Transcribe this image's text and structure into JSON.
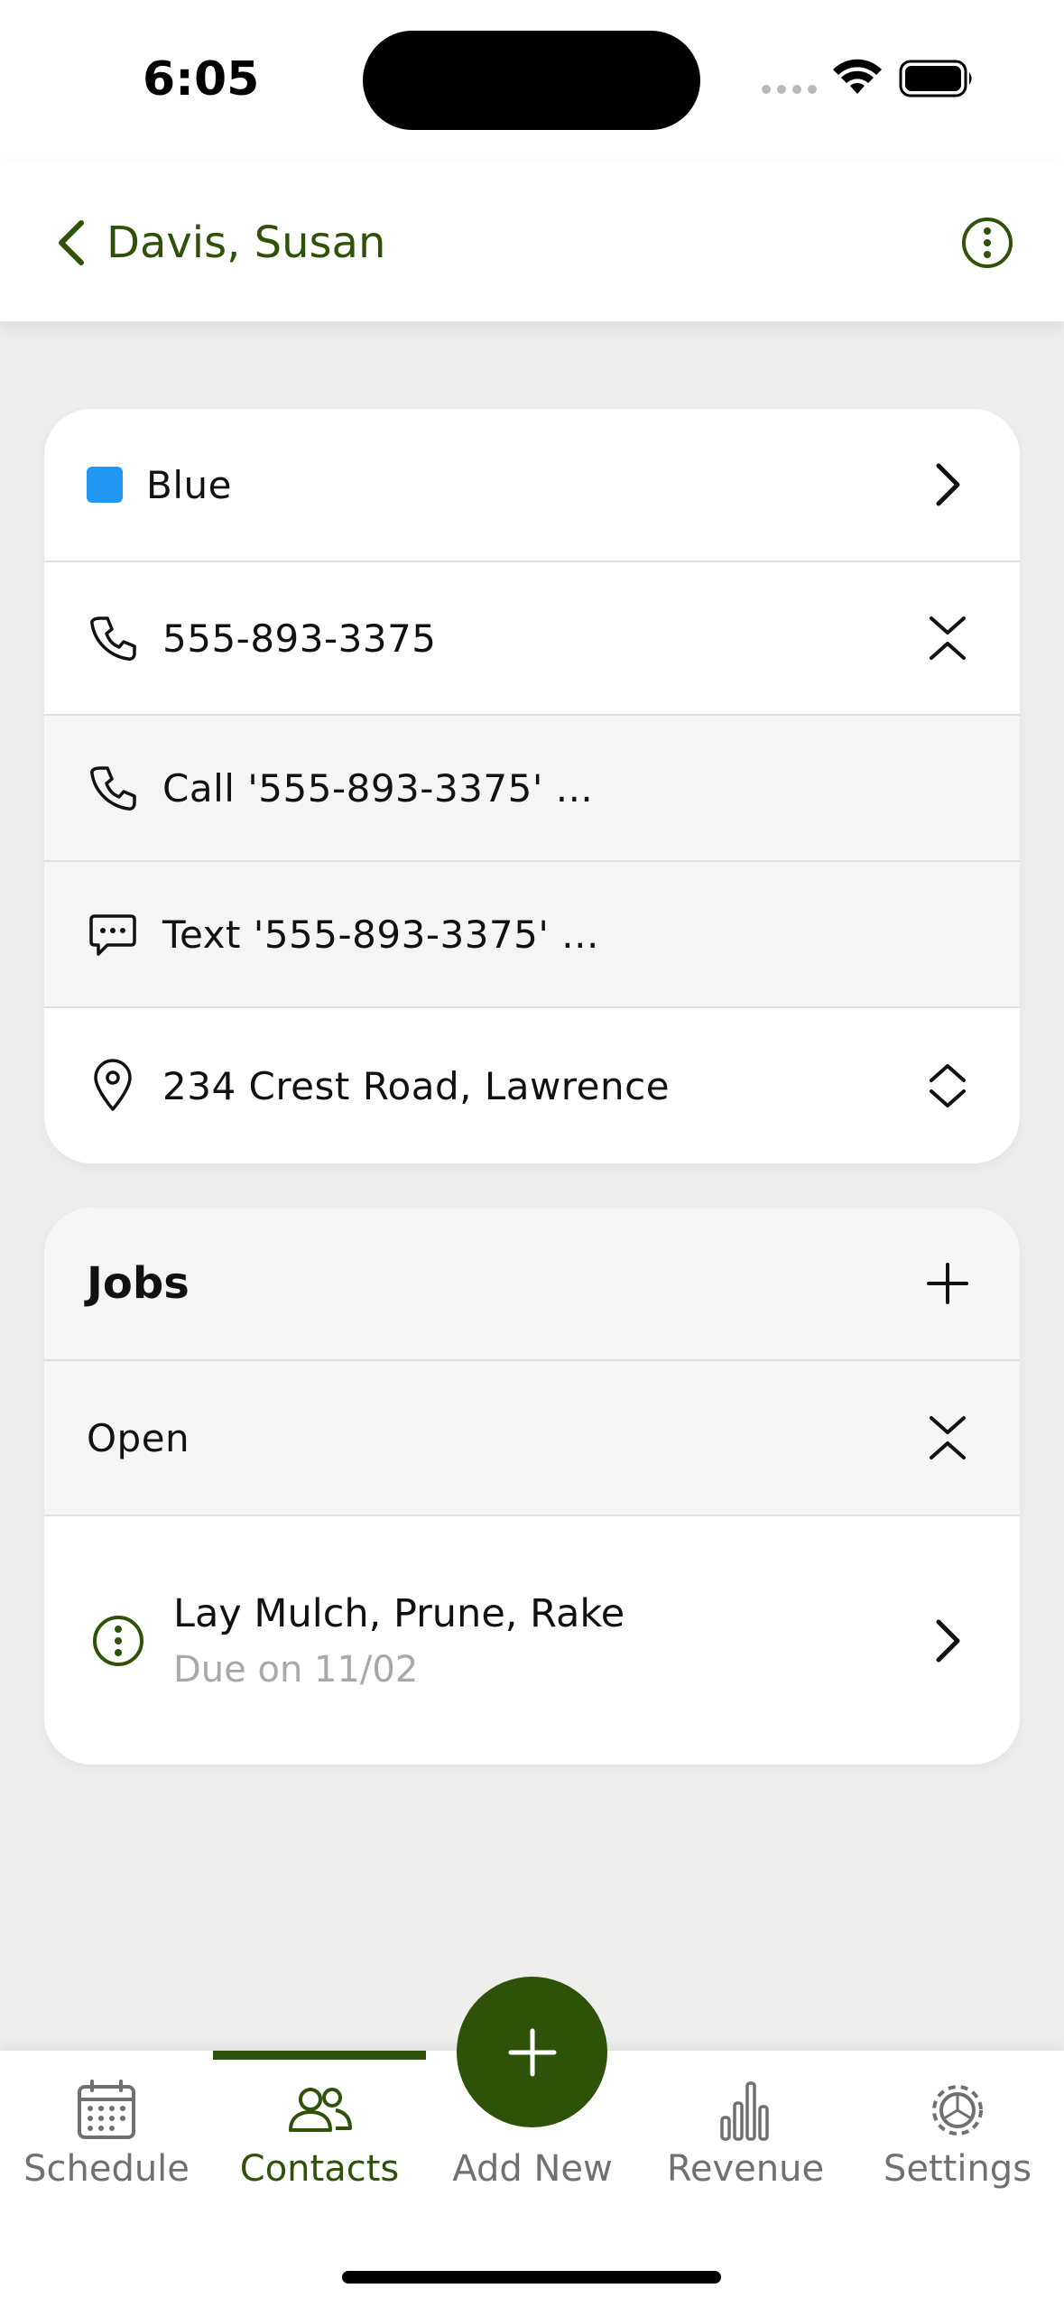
{
  "status": {
    "time": "6:05"
  },
  "header": {
    "back_label": "Davis, Susan"
  },
  "contact": {
    "category": {
      "label": "Blue",
      "color": "#2196f3"
    },
    "phone": "555-893-3375",
    "call_action": "Call '555-893-3375' ...",
    "text_action": "Text '555-893-3375' ...",
    "address": "234 Crest Road, Lawrence"
  },
  "jobs": {
    "title": "Jobs",
    "section": "Open",
    "items": [
      {
        "title": "Lay Mulch, Prune, Rake",
        "due": "Due on 11/02"
      }
    ]
  },
  "tabs": [
    {
      "label": "Schedule",
      "icon": "calendar-icon"
    },
    {
      "label": "Contacts",
      "icon": "people-icon",
      "active": true
    },
    {
      "label": "Add New",
      "icon": "plus-icon"
    },
    {
      "label": "Revenue",
      "icon": "bar-chart-icon"
    },
    {
      "label": "Settings",
      "icon": "gear-icon"
    }
  ],
  "colors": {
    "accent": "#2e5208",
    "inactive": "#707070"
  }
}
